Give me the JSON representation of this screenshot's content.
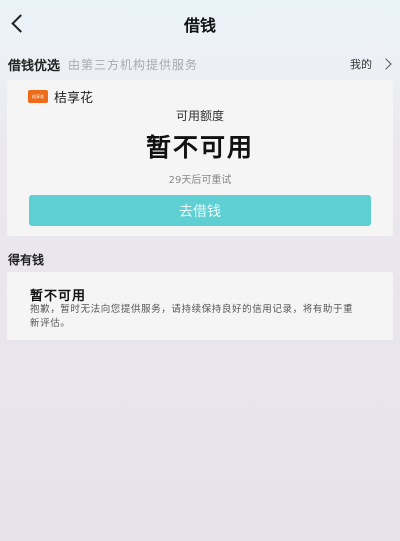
{
  "header": {
    "title": "借钱",
    "back_icon": "chevron-left-icon"
  },
  "section_best": {
    "title": "借钱优选",
    "subtitle": "由第三方机构提供服务",
    "mine_label": "我的",
    "mine_icon": "chevron-right-icon"
  },
  "card_main": {
    "brand_logo_text": "桔享花",
    "brand_name": "桔享花",
    "quota_label": "可用额度",
    "quota_status": "暂不可用",
    "retry_text": "29天后可重试",
    "button_label": "去借钱",
    "button_color": "#5ecfd2",
    "brand_color": "#ee6b1a"
  },
  "section_deyouqian": {
    "title": "得有钱",
    "card_title": "暂不可用",
    "card_desc": "抱歉，暂时无法向您提供服务，请持续保持良好的信用记录，将有助于重新评估。"
  }
}
